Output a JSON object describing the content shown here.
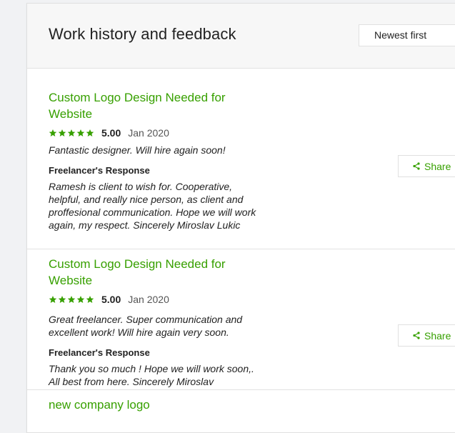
{
  "header": {
    "title": "Work history and feedback",
    "sort_label": "Newest first"
  },
  "colors": {
    "accent": "#37a000",
    "star": "#37a000"
  },
  "entries": [
    {
      "title": "Custom Logo Design Needed for Website",
      "rating": 5,
      "score": "5.00",
      "date": "Jan 2020",
      "feedback": "Fantastic designer. Will hire again soon!",
      "response_label": "Freelancer's Response",
      "response": "Ramesh is client to wish for. Cooperative, helpful, and really nice person, as client and proffesional communication. Hope we will work again, my respect. Sincerely Miroslav Lukic",
      "share_label": "Share"
    },
    {
      "title": "Custom Logo Design Needed for Website",
      "rating": 5,
      "score": "5.00",
      "date": "Jan 2020",
      "feedback": "Great freelancer. Super communication and excellent work! Will hire again very soon.",
      "response_label": "Freelancer's Response",
      "response": "Thank you so much ! Hope we will work soon,. All best from here. Sincerely Miroslav",
      "share_label": "Share"
    },
    {
      "title": "new company logo"
    }
  ],
  "icons": {
    "star": "star-icon",
    "share": "share-icon"
  }
}
